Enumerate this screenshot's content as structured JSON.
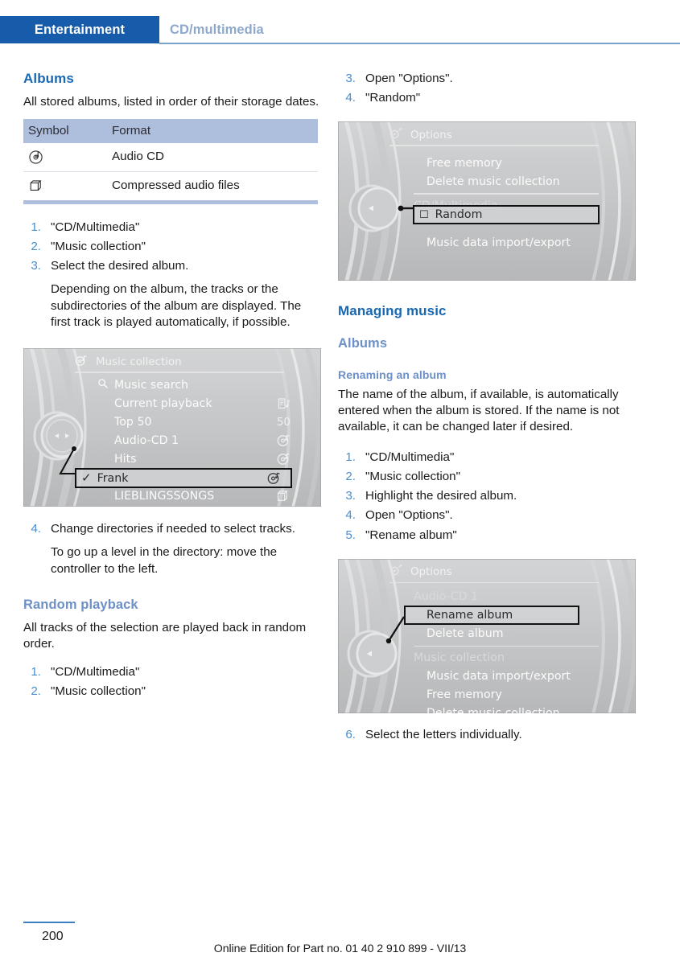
{
  "header": {
    "tab_active": "Entertainment",
    "tab_inactive": "CD/multimedia"
  },
  "colors": {
    "tab_blue": "#165caa",
    "heading_blue": "#1868b3",
    "subheading_blue": "#6d90c6",
    "list_number_blue": "#4b8fd0",
    "table_header_bg": "#aebfdd",
    "footer_rule": "#3a7fbf"
  },
  "left_column": {
    "albums_heading": "Albums",
    "albums_intro": "All stored albums, listed in order of their storage dates.",
    "table": {
      "headers": [
        "Symbol",
        "Format"
      ],
      "rows": [
        {
          "symbol": "audio-cd-icon",
          "format": "Audio CD"
        },
        {
          "symbol": "folder-icon",
          "format": "Compressed audio files"
        }
      ]
    },
    "steps": [
      {
        "num": "1.",
        "text": "\"CD/Multimedia\""
      },
      {
        "num": "2.",
        "text": "\"Music collection\""
      },
      {
        "num": "3.",
        "text": "Select the desired album.",
        "note": "Depending on the album, the tracks or the subdirectories of the album are displayed. The first track is played automatically, if possible."
      }
    ],
    "screen_music_collection": {
      "title": "Music collection",
      "title_icon": "music-note-disc-icon",
      "rows": [
        {
          "label": "Music search",
          "left_icon": "search-icon",
          "right": ""
        },
        {
          "label": "Current playback",
          "right_icon": "playlist-note-icon"
        },
        {
          "label": "Top 50",
          "right": "50"
        },
        {
          "label": "Audio-CD 1",
          "right_icon": "cd-icon"
        },
        {
          "label": "Hits",
          "right_icon": "cd-icon"
        },
        {
          "label": "Frank",
          "right_icon": "cd-icon",
          "highlighted": true,
          "check": "✓"
        },
        {
          "label": "LIEBLINGSSONGS",
          "right_icon": "folder-icon"
        }
      ]
    },
    "steps2": [
      {
        "num": "4.",
        "text": "Change directories if needed to select tracks.",
        "note": "To go up a level in the directory: move the controller to the left."
      }
    ],
    "random_heading": "Random playback",
    "random_intro": "All tracks of the selection are played back in random order.",
    "random_steps": [
      {
        "num": "1.",
        "text": "\"CD/Multimedia\""
      },
      {
        "num": "2.",
        "text": "\"Music collection\""
      }
    ]
  },
  "right_column": {
    "steps_top": [
      {
        "num": "3.",
        "text": "Open \"Options\"."
      },
      {
        "num": "4.",
        "text": "\"Random\""
      }
    ],
    "screen_options_random": {
      "title": "Options",
      "title_icon": "options-gear-icon",
      "rows": [
        {
          "label": "Free memory"
        },
        {
          "label": "Delete music collection"
        },
        {
          "separator": true
        },
        {
          "label": "CD/Multimedia",
          "group": true
        },
        {
          "label": "Random",
          "highlighted": true,
          "checkbox": "☐"
        },
        {
          "label": "Music data import/export"
        }
      ]
    },
    "managing_heading": "Managing music",
    "albums_subheading": "Albums",
    "renaming_heading": "Renaming an album",
    "renaming_body": "The name of the album, if available, is automatically entered when the album is stored. If the name is not available, it can be changed later if desired.",
    "renaming_steps": [
      {
        "num": "1.",
        "text": "\"CD/Multimedia\""
      },
      {
        "num": "2.",
        "text": "\"Music collection\""
      },
      {
        "num": "3.",
        "text": "Highlight the desired album."
      },
      {
        "num": "4.",
        "text": "Open \"Options\"."
      },
      {
        "num": "5.",
        "text": "\"Rename album\""
      }
    ],
    "screen_options_rename": {
      "title": "Options",
      "title_icon": "options-gear-icon",
      "rows": [
        {
          "label": "Audio-CD 1",
          "group": true
        },
        {
          "label": "Rename album",
          "highlighted": true
        },
        {
          "label": "Delete album"
        },
        {
          "separator": true
        },
        {
          "label": "Music collection",
          "group": true
        },
        {
          "label": "Music data import/export"
        },
        {
          "label": "Free memory"
        },
        {
          "label": "Delete music collection"
        }
      ]
    },
    "final_step": {
      "num": "6.",
      "text": "Select the letters individually."
    }
  },
  "footer": {
    "page_number": "200",
    "edition_text": "Online Edition for Part no. 01 40 2 910 899 - VII/13"
  }
}
